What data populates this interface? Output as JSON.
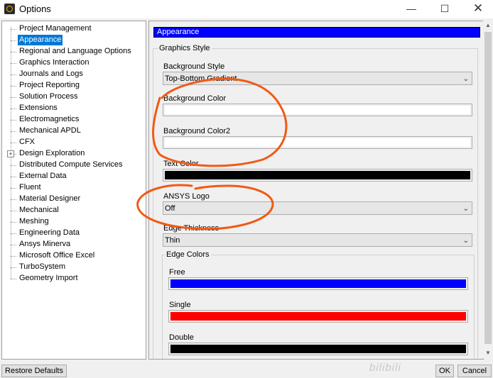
{
  "window": {
    "title": "Options"
  },
  "tree": {
    "items": [
      {
        "label": "Project Management"
      },
      {
        "label": "Appearance",
        "selected": true
      },
      {
        "label": "Regional and Language Options"
      },
      {
        "label": "Graphics Interaction"
      },
      {
        "label": "Journals and Logs"
      },
      {
        "label": "Project Reporting"
      },
      {
        "label": "Solution Process"
      },
      {
        "label": "Extensions"
      },
      {
        "label": "Electromagnetics"
      },
      {
        "label": "Mechanical APDL"
      },
      {
        "label": "CFX"
      },
      {
        "label": "Design Exploration",
        "expandable": true
      },
      {
        "label": "Distributed Compute Services"
      },
      {
        "label": "External Data"
      },
      {
        "label": "Fluent"
      },
      {
        "label": "Material Designer"
      },
      {
        "label": "Mechanical"
      },
      {
        "label": "Meshing"
      },
      {
        "label": "Engineering Data"
      },
      {
        "label": "Ansys Minerva"
      },
      {
        "label": "Microsoft Office Excel"
      },
      {
        "label": "TurboSystem"
      },
      {
        "label": "Geometry Import"
      }
    ]
  },
  "panel": {
    "header": "Appearance",
    "graphics_style": {
      "title": "Graphics Style",
      "background_style": {
        "label": "Background Style",
        "value": "Top-Bottom Gradient"
      },
      "background_color": {
        "label": "Background Color",
        "color": "#ffffff"
      },
      "background_color2": {
        "label": "Background Color2",
        "color": "#ffffff"
      },
      "text_color": {
        "label": "Text Color",
        "color": "#000000"
      },
      "ansys_logo": {
        "label": "ANSYS Logo",
        "value": "Off"
      },
      "edge_thickness": {
        "label": "Edge Thickness",
        "value": "Thin"
      },
      "edge_colors": {
        "title": "Edge Colors",
        "free": {
          "label": "Free",
          "color": "#0000ff"
        },
        "single": {
          "label": "Single",
          "color": "#ff0000"
        },
        "double": {
          "label": "Double",
          "color": "#000000"
        }
      }
    }
  },
  "buttons": {
    "restore": "Restore Defaults",
    "ok": "OK",
    "cancel": "Cancel"
  },
  "icons": {
    "dropdown_arrow": "chevron-down-icon",
    "app": "ansys-app-icon"
  },
  "annotations": {
    "color": "#f05a14"
  },
  "watermark": "bilibili"
}
